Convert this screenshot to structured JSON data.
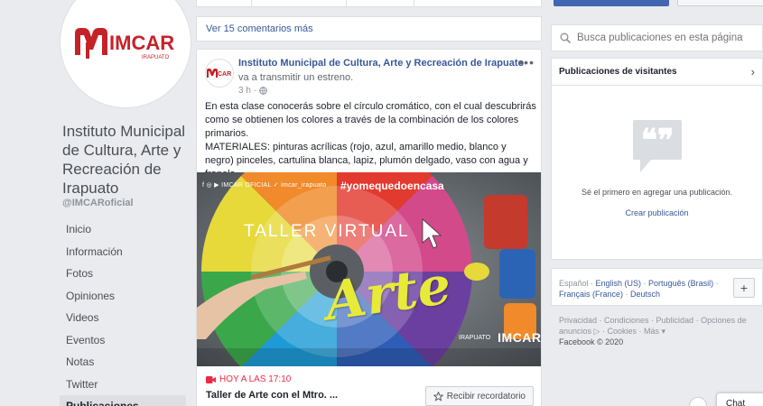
{
  "page": {
    "name": "Instituto Municipal de Cultura, Arte y Recreación de Irapuato",
    "handle": "@IMCARoficial",
    "logo_text": "IMCAR",
    "logo_subtext": "IRAPUATO"
  },
  "left_nav": {
    "items": [
      {
        "label": "Inicio"
      },
      {
        "label": "Información"
      },
      {
        "label": "Fotos"
      },
      {
        "label": "Opiniones"
      },
      {
        "label": "Videos"
      },
      {
        "label": "Eventos"
      },
      {
        "label": "Notas"
      },
      {
        "label": "Twitter"
      },
      {
        "label": "Publicaciones"
      }
    ]
  },
  "feed": {
    "more_comments": "Ver 15 comentarios más"
  },
  "post": {
    "author": "Instituto Municipal de Cultura, Arte y Recreación de Irapuato",
    "action": "va a transmitir un estreno.",
    "time": "3 h",
    "body_lines": [
      "En esta clase conocerás sobre el círculo cromático, con el cual descubrirás como se obtienen los colores a través de la combinación de los colores primarios.",
      "MATERIALES: pinturas acrílicas (rojo, azul, amarillo medio, blanco y negro) pinceles, cartulina blanca, lapiz, plumón delgado, vaso con agua y franela."
    ],
    "image": {
      "social_handles": "f ◎ ▶ IMCAR OFICIAL  ✓ imcar_irapuato",
      "hashtag": "#yomequedoencasa",
      "headline": "TALLER VIRTUAL",
      "big_word": "Arte",
      "footer_left": "IRAPUATO",
      "footer_right": "IMCAR"
    },
    "event_date": "HOY A LAS 17:10",
    "event_title": "Taller de Arte con el Mtro. ...",
    "remind_label": "Recibir recordatorio"
  },
  "sidebar": {
    "search_placeholder": "Busca publicaciones en esta página",
    "visitor_title": "Publicaciones de visitantes",
    "visitor_empty": "Sé el primero en agregar una publicación.",
    "create_post": "Crear publicación",
    "languages": {
      "current": "Español",
      "others": [
        "English (US)",
        "Português (Brasil)",
        "Français (France)",
        "Deutsch"
      ]
    },
    "footer_links": "Privacidad · Condiciones · Publicidad · Opciones de anuncios ▷ · Cookies · Más ▾",
    "copyright": "Facebook © 2020"
  },
  "chat": {
    "label": "Chat"
  },
  "colors": {
    "link": "#385898",
    "primary_button": "#4267b2",
    "event_red": "#f02849",
    "arte_yellow": "#e8ea3a"
  }
}
